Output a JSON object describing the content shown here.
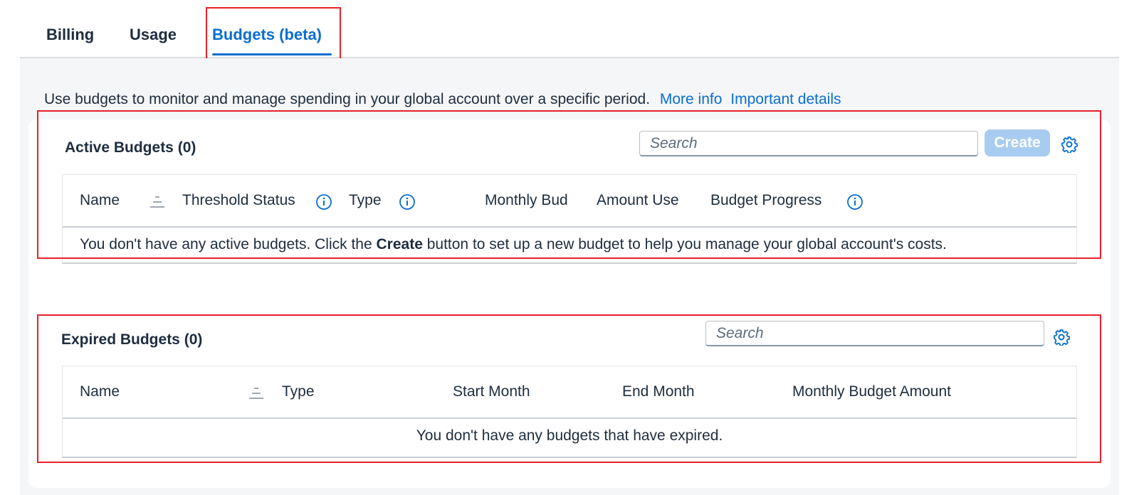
{
  "tabs": [
    {
      "label": "Billing"
    },
    {
      "label": "Usage"
    },
    {
      "label": "Budgets (beta)"
    }
  ],
  "intro": {
    "text": "Use budgets to monitor and manage spending in your global account over a specific period.",
    "more_info_link": "More info",
    "important_details_link": "Important details"
  },
  "active": {
    "title": "Active Budgets (0)",
    "search_placeholder": "Search",
    "create_label": "Create",
    "columns": [
      "Name",
      "Threshold Status",
      "Type",
      "Monthly Bud",
      "Amount Use­",
      "Budget Progress"
    ],
    "empty_before": "You don't have any active budgets. Click the ",
    "empty_bold": "Create",
    "empty_after": " button to set up a new budget to help you manage your global account's costs."
  },
  "expired": {
    "title": "Expired Budgets (0)",
    "search_placeholder": "Search",
    "columns": [
      "Name",
      "Type",
      "Start Month",
      "End Month",
      "Monthly Budget Amount"
    ],
    "empty_text": "You don't have any budgets that have expired."
  },
  "colors": {
    "accent": "#0a6ed1",
    "highlight": "#e8202a",
    "create_disabled": "#a7ccf0"
  },
  "icons": [
    "gear-icon",
    "info-icon",
    "sort-icon"
  ]
}
